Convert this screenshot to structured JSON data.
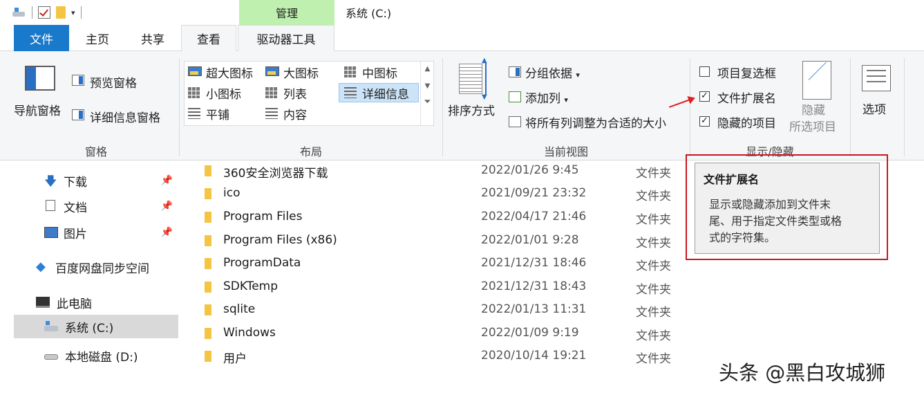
{
  "titlebar": {
    "context_tab": "管理",
    "window_title": "系统 (C:)"
  },
  "tabs": {
    "file": "文件",
    "home": "主页",
    "share": "共享",
    "view": "查看",
    "drive_tools": "驱动器工具"
  },
  "ribbon": {
    "panes": {
      "nav_pane": "导航窗格",
      "preview_pane": "预览窗格",
      "details_pane": "详细信息窗格",
      "group_label": "窗格"
    },
    "layout": {
      "extra_large": "超大图标",
      "large": "大图标",
      "medium": "中图标",
      "small": "小图标",
      "list": "列表",
      "details": "详细信息",
      "tiles": "平铺",
      "content": "内容",
      "group_label": "布局"
    },
    "current_view": {
      "sort_by": "排序方式",
      "group_by": "分组依据",
      "add_columns": "添加列",
      "size_all_columns": "将所有列调整为合适的大小",
      "group_label": "当前视图"
    },
    "show_hide": {
      "item_checkboxes": "项目复选框",
      "file_extensions": "文件扩展名",
      "hidden_items": "隐藏的项目",
      "hide_selected_line1": "隐藏",
      "hide_selected_line2": "所选项目",
      "group_label": "显示/隐藏"
    },
    "options": "选项"
  },
  "nav": {
    "items": [
      {
        "label": "下载",
        "pinned": true
      },
      {
        "label": "文档",
        "pinned": true
      },
      {
        "label": "图片",
        "pinned": true
      },
      {
        "label": "百度网盘同步空间"
      },
      {
        "label": "此电脑"
      },
      {
        "label": "系统 (C:)",
        "selected": true
      },
      {
        "label": "本地磁盘 (D:)"
      }
    ]
  },
  "files": [
    {
      "name": "360安全浏览器下载",
      "date": "2022/01/26 9:45",
      "type": "文件夹"
    },
    {
      "name": "ico",
      "date": "2021/09/21 23:32",
      "type": "文件夹"
    },
    {
      "name": "Program Files",
      "date": "2022/04/17 21:46",
      "type": "文件夹"
    },
    {
      "name": "Program Files (x86)",
      "date": "2022/01/01 9:28",
      "type": "文件夹"
    },
    {
      "name": "ProgramData",
      "date": "2021/12/31 18:46",
      "type": "文件夹"
    },
    {
      "name": "SDKTemp",
      "date": "2021/12/31 18:43",
      "type": "文件夹"
    },
    {
      "name": "sqlite",
      "date": "2022/01/13 11:31",
      "type": "文件夹"
    },
    {
      "name": "Windows",
      "date": "2022/01/09 9:19",
      "type": "文件夹"
    },
    {
      "name": "用户",
      "date": "2020/10/14 19:21",
      "type": "文件夹"
    }
  ],
  "tooltip": {
    "title": "文件扩展名",
    "body_line1": "显示或隐藏添加到文件末",
    "body_line2": "尾、用于指定文件类型或格",
    "body_line3": "式的字符集。"
  },
  "watermark": "头条 @黑白攻城狮",
  "colors": {
    "file_tab": "#1979ca",
    "context_tab": "#bff0b0",
    "highlight_frame": "#c8161d",
    "folder": "#f4c542"
  }
}
